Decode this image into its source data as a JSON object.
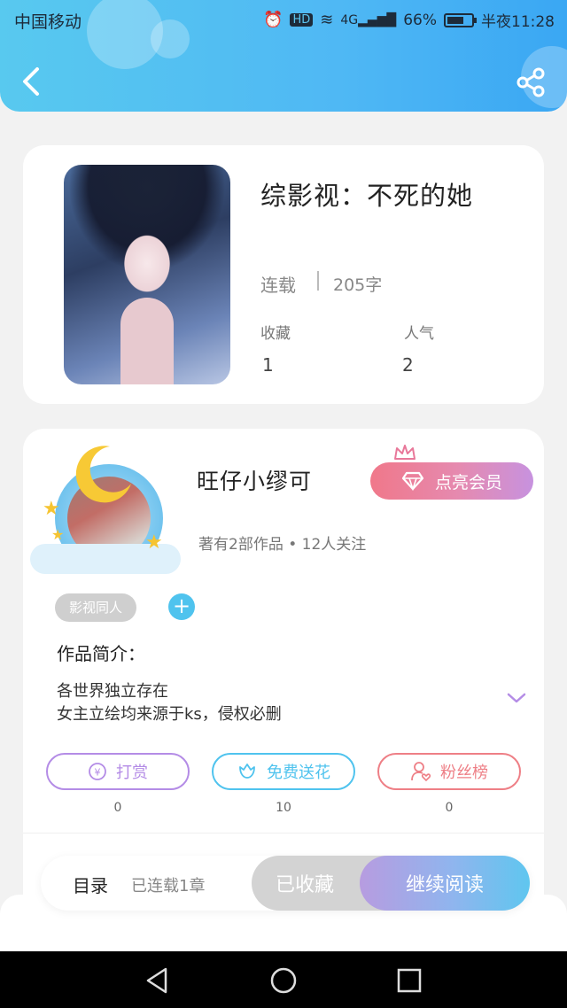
{
  "status_bar": {
    "carrier": "中国移动",
    "battery": "66%",
    "time": "半夜11:28",
    "icons": [
      "alarm-icon",
      "hd-icon",
      "wifi-icon",
      "4g-signal-icon",
      "battery-icon"
    ]
  },
  "header": {
    "back_icon": "chevron-left-icon",
    "share_icon": "share-icon",
    "gradient": [
      "#58c9ef",
      "#3aa7f3"
    ]
  },
  "book": {
    "title": "综影视：不死的她",
    "status": "连载",
    "word_count": "205字",
    "stats": [
      {
        "label": "收藏",
        "value": "1"
      },
      {
        "label": "人气",
        "value": "2"
      }
    ]
  },
  "author": {
    "name": "旺仔小缪可",
    "meta": "著有2部作品 • 12人关注",
    "vip_button": "点亮会员"
  },
  "tags": [
    "影视同人"
  ],
  "intro": {
    "heading": "作品简介：",
    "lines": [
      "各世界独立存在",
      "女主立绘均来源于ks，侵权必删"
    ]
  },
  "actions": [
    {
      "label": "打赏",
      "count": "0",
      "color": "#b48ce6",
      "icon": "yen-coin-icon"
    },
    {
      "label": "免费送花",
      "count": "10",
      "color": "#4fc3ee",
      "icon": "flower-icon"
    },
    {
      "label": "粉丝榜",
      "count": "0",
      "color": "#ee7f86",
      "icon": "user-heart-icon"
    }
  ],
  "read_bar": {
    "toc_label": "目录",
    "toc_sub": "已连载1章",
    "collected": "已收藏",
    "continue": "继续阅读"
  },
  "nav_bar": {
    "icons": [
      "back-triangle-icon",
      "home-circle-icon",
      "recents-square-icon"
    ]
  }
}
